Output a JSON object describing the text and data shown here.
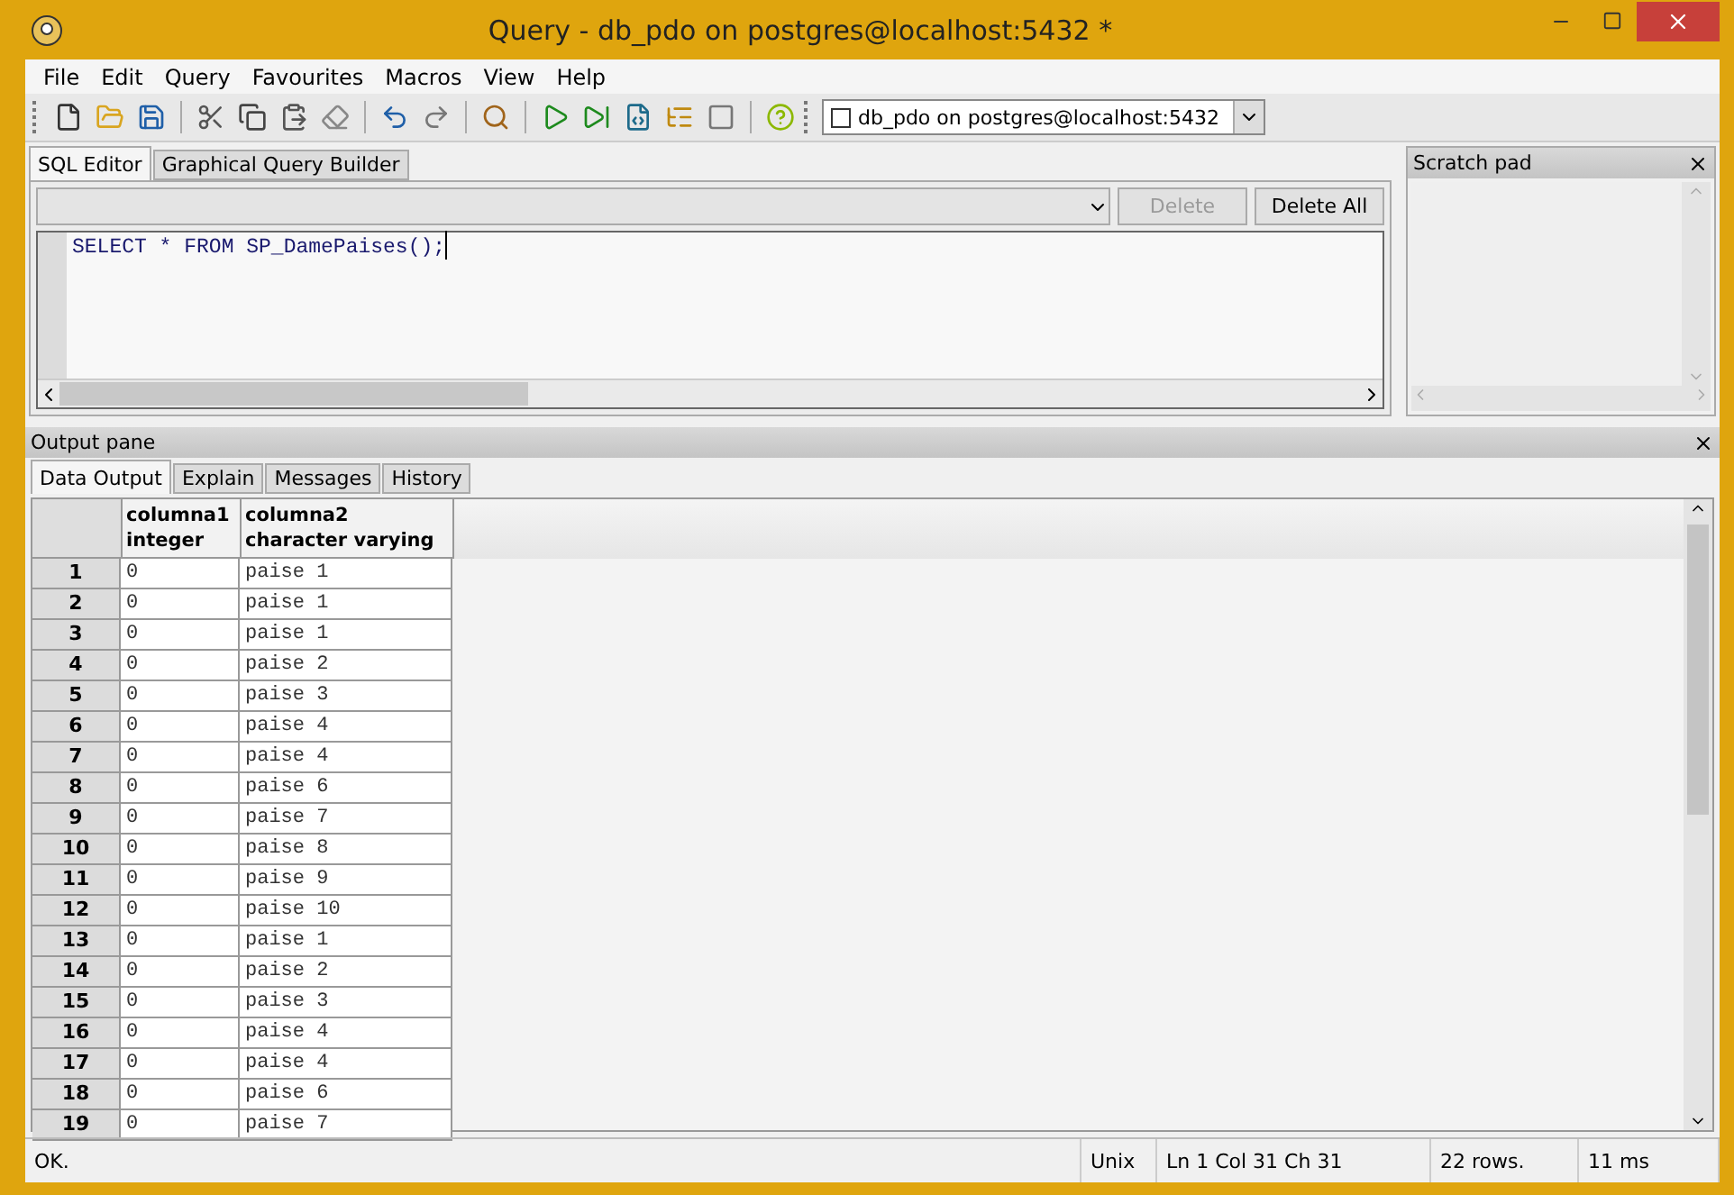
{
  "window": {
    "title": "Query - db_pdo on postgres@localhost:5432 *"
  },
  "menu": [
    "File",
    "Edit",
    "Query",
    "Favourites",
    "Macros",
    "View",
    "Help"
  ],
  "connection": {
    "checked": false,
    "label": "db_pdo on postgres@localhost:5432"
  },
  "editor_tabs": [
    {
      "label": "SQL Editor",
      "selected": true
    },
    {
      "label": "Graphical Query Builder",
      "selected": false
    }
  ],
  "editor_buttons": [
    {
      "label": "Delete",
      "disabled": true
    },
    {
      "label": "Delete All",
      "disabled": false
    }
  ],
  "sql": "SELECT * FROM SP_DamePaises();",
  "scratch_pad": {
    "title": "Scratch pad"
  },
  "output_pane": {
    "title": "Output pane",
    "tabs": [
      {
        "label": "Data Output",
        "selected": true
      },
      {
        "label": "Explain",
        "selected": false
      },
      {
        "label": "Messages",
        "selected": false
      },
      {
        "label": "History",
        "selected": false
      }
    ],
    "columns": [
      {
        "name": "columna1",
        "type": "integer"
      },
      {
        "name": "columna2",
        "type": "character varying"
      }
    ],
    "rows": [
      {
        "n": "1",
        "c1": "0",
        "c2": "paise 1"
      },
      {
        "n": "2",
        "c1": "0",
        "c2": "paise 1"
      },
      {
        "n": "3",
        "c1": "0",
        "c2": "paise 1"
      },
      {
        "n": "4",
        "c1": "0",
        "c2": "paise 2"
      },
      {
        "n": "5",
        "c1": "0",
        "c2": "paise 3"
      },
      {
        "n": "6",
        "c1": "0",
        "c2": "paise 4"
      },
      {
        "n": "7",
        "c1": "0",
        "c2": "paise 4"
      },
      {
        "n": "8",
        "c1": "0",
        "c2": "paise 6"
      },
      {
        "n": "9",
        "c1": "0",
        "c2": "paise 7"
      },
      {
        "n": "10",
        "c1": "0",
        "c2": "paise 8"
      },
      {
        "n": "11",
        "c1": "0",
        "c2": "paise 9"
      },
      {
        "n": "12",
        "c1": "0",
        "c2": "paise 10"
      },
      {
        "n": "13",
        "c1": "0",
        "c2": "paise 1"
      },
      {
        "n": "14",
        "c1": "0",
        "c2": "paise 2"
      },
      {
        "n": "15",
        "c1": "0",
        "c2": "paise 3"
      },
      {
        "n": "16",
        "c1": "0",
        "c2": "paise 4"
      },
      {
        "n": "17",
        "c1": "0",
        "c2": "paise 4"
      },
      {
        "n": "18",
        "c1": "0",
        "c2": "paise 6"
      },
      {
        "n": "19",
        "c1": "0",
        "c2": "paise 7"
      }
    ]
  },
  "status_bar": {
    "message": "OK.",
    "line_ending": "Unix",
    "position": "Ln 1 Col 31 Ch 31",
    "rows": "22 rows.",
    "time": "11 ms"
  }
}
